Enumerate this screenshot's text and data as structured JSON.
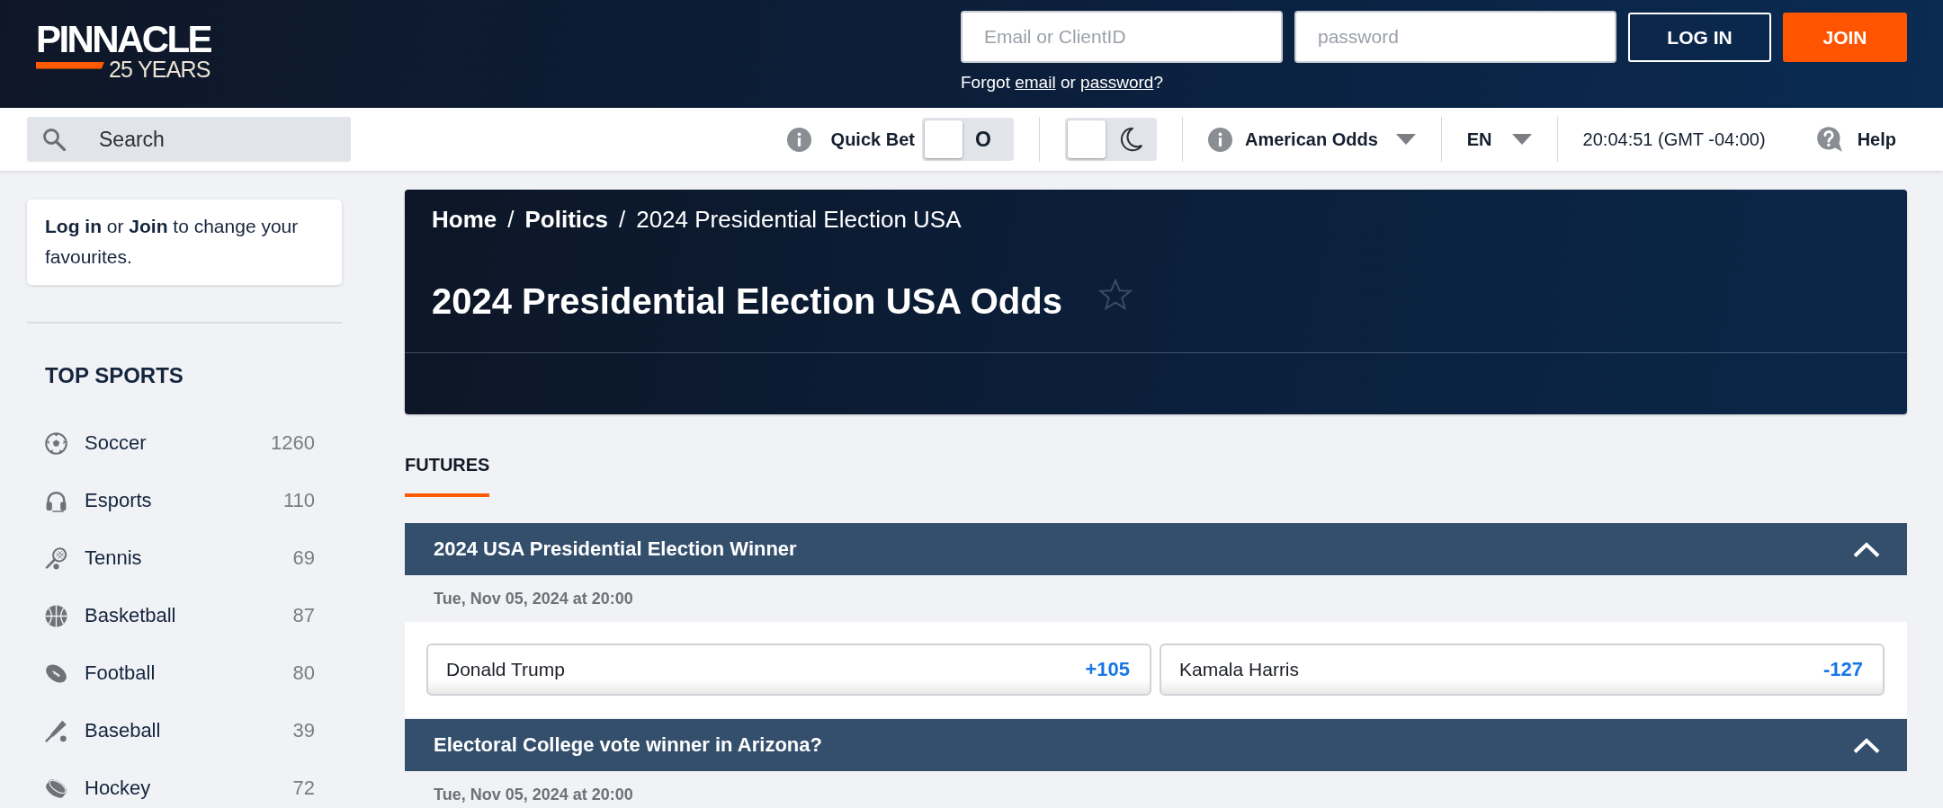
{
  "header": {
    "logo": {
      "brand": "PINNACLE",
      "tagline": "25 YEARS"
    },
    "email_field": {
      "placeholder": "Email or ClientID"
    },
    "password_field": {
      "placeholder": "password"
    },
    "buttons": [
      {
        "label": "LOG IN",
        "kind": "outline"
      },
      {
        "label": "JOIN",
        "kind": "primary"
      }
    ],
    "forgot": [
      {
        "text": "Forgot ",
        "kind": "text"
      },
      {
        "text": "email",
        "kind": "link"
      },
      {
        "text": " or ",
        "kind": "text"
      },
      {
        "text": "password",
        "kind": "link"
      },
      {
        "text": "?",
        "kind": "text"
      }
    ]
  },
  "toolbar": {
    "search": {
      "placeholder": "Search"
    },
    "quick_bet": {
      "label": "Quick Bet",
      "on": false,
      "toggle_text": "O"
    },
    "dark_mode": {
      "on": false
    },
    "odds_format": {
      "label": "American Odds"
    },
    "language": {
      "label": "EN"
    },
    "clock": "20:04:51 (GMT -04:00)",
    "help": {
      "label": "Help"
    }
  },
  "sidebar": {
    "notice": "**Log in** or **Join** to change your favourites.",
    "section_title": "TOP SPORTS",
    "sports": [
      {
        "name": "Soccer",
        "count": "1260",
        "kind": "soccer"
      },
      {
        "name": "Esports",
        "count": "110",
        "kind": "esports"
      },
      {
        "name": "Tennis",
        "count": "69",
        "kind": "tennis"
      },
      {
        "name": "Basketball",
        "count": "87",
        "kind": "basketball"
      },
      {
        "name": "Football",
        "count": "80",
        "kind": "football"
      },
      {
        "name": "Baseball",
        "count": "39",
        "kind": "baseball"
      },
      {
        "name": "Hockey",
        "count": "72",
        "kind": "hockey"
      }
    ]
  },
  "main": {
    "breadcrumb": [
      {
        "text": "Home",
        "kind": "link"
      },
      {
        "text": "/",
        "kind": "separator"
      },
      {
        "text": "Politics",
        "kind": "link"
      },
      {
        "text": "/",
        "kind": "separator"
      },
      {
        "text": "2024 Presidential Election USA",
        "kind": "current"
      }
    ],
    "title": "2024 Presidential Election USA Odds",
    "favourite": {
      "starred": false
    },
    "tabs": [
      {
        "label": "FUTURES",
        "selected": true
      }
    ],
    "markets": [
      {
        "title": "2024 USA Presidential Election Winner",
        "expanded": true,
        "date": "Tue, Nov 05, 2024 at 20:00",
        "selections": [
          {
            "name": "Donald Trump",
            "price": "+105"
          },
          {
            "name": "Kamala Harris",
            "price": "-127"
          }
        ]
      },
      {
        "title": "Electoral College vote winner in Arizona?",
        "expanded": true,
        "date": "Tue, Nov 05, 2024 at 20:00"
      }
    ]
  }
}
